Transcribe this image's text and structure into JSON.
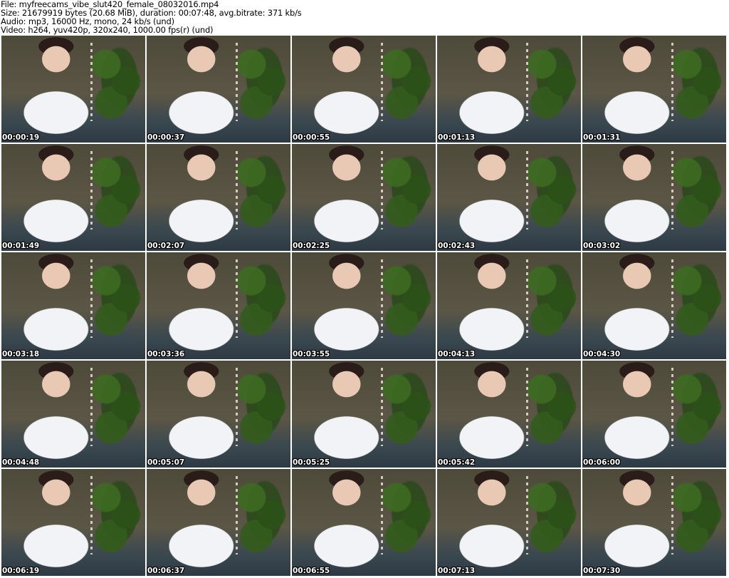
{
  "header": {
    "file": "File: myfreecams_vibe_slut420_female_08032016.mp4",
    "size": "Size: 21679919 bytes (20.68 MiB), duration: 00:07:48, avg.bitrate: 371 kb/s",
    "audio": "Audio: mp3, 16000 Hz, mono, 24 kb/s (und)",
    "video": "Video: h264, yuv420p, 320x240, 1000.00 fps(r) (und)"
  },
  "thumbnails": [
    "00:00:19",
    "00:00:37",
    "00:00:55",
    "00:01:13",
    "00:01:31",
    "00:01:49",
    "00:02:07",
    "00:02:25",
    "00:02:43",
    "00:03:02",
    "00:03:18",
    "00:03:36",
    "00:03:55",
    "00:04:13",
    "00:04:30",
    "00:04:48",
    "00:05:07",
    "00:05:25",
    "00:05:42",
    "00:06:00",
    "00:06:19",
    "00:06:37",
    "00:06:55",
    "00:07:13",
    "00:07:30"
  ]
}
